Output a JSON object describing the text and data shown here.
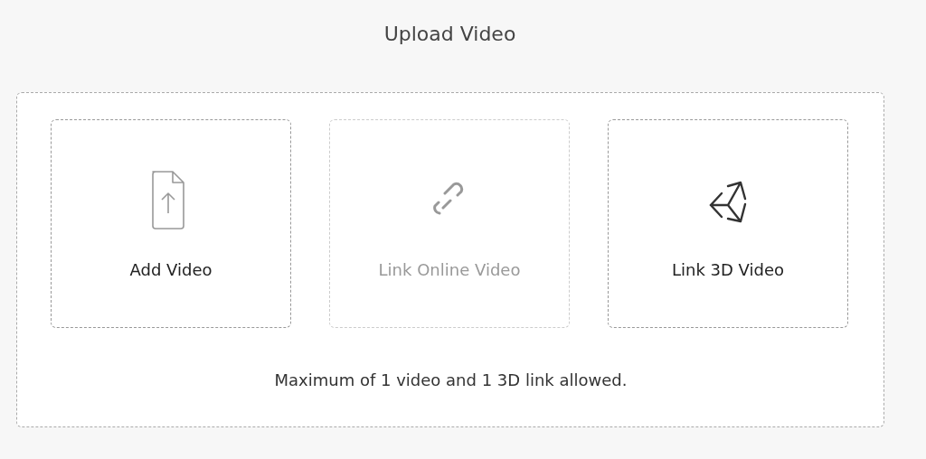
{
  "title": "Upload Video",
  "options": [
    {
      "kind": "upload",
      "label": "Add Video",
      "disabled": false
    },
    {
      "kind": "link",
      "label": "Link Online Video",
      "disabled": true
    },
    {
      "kind": "cube",
      "label": "Link 3D Video",
      "disabled": false
    }
  ],
  "note": "Maximum of 1 video and 1 3D link allowed."
}
